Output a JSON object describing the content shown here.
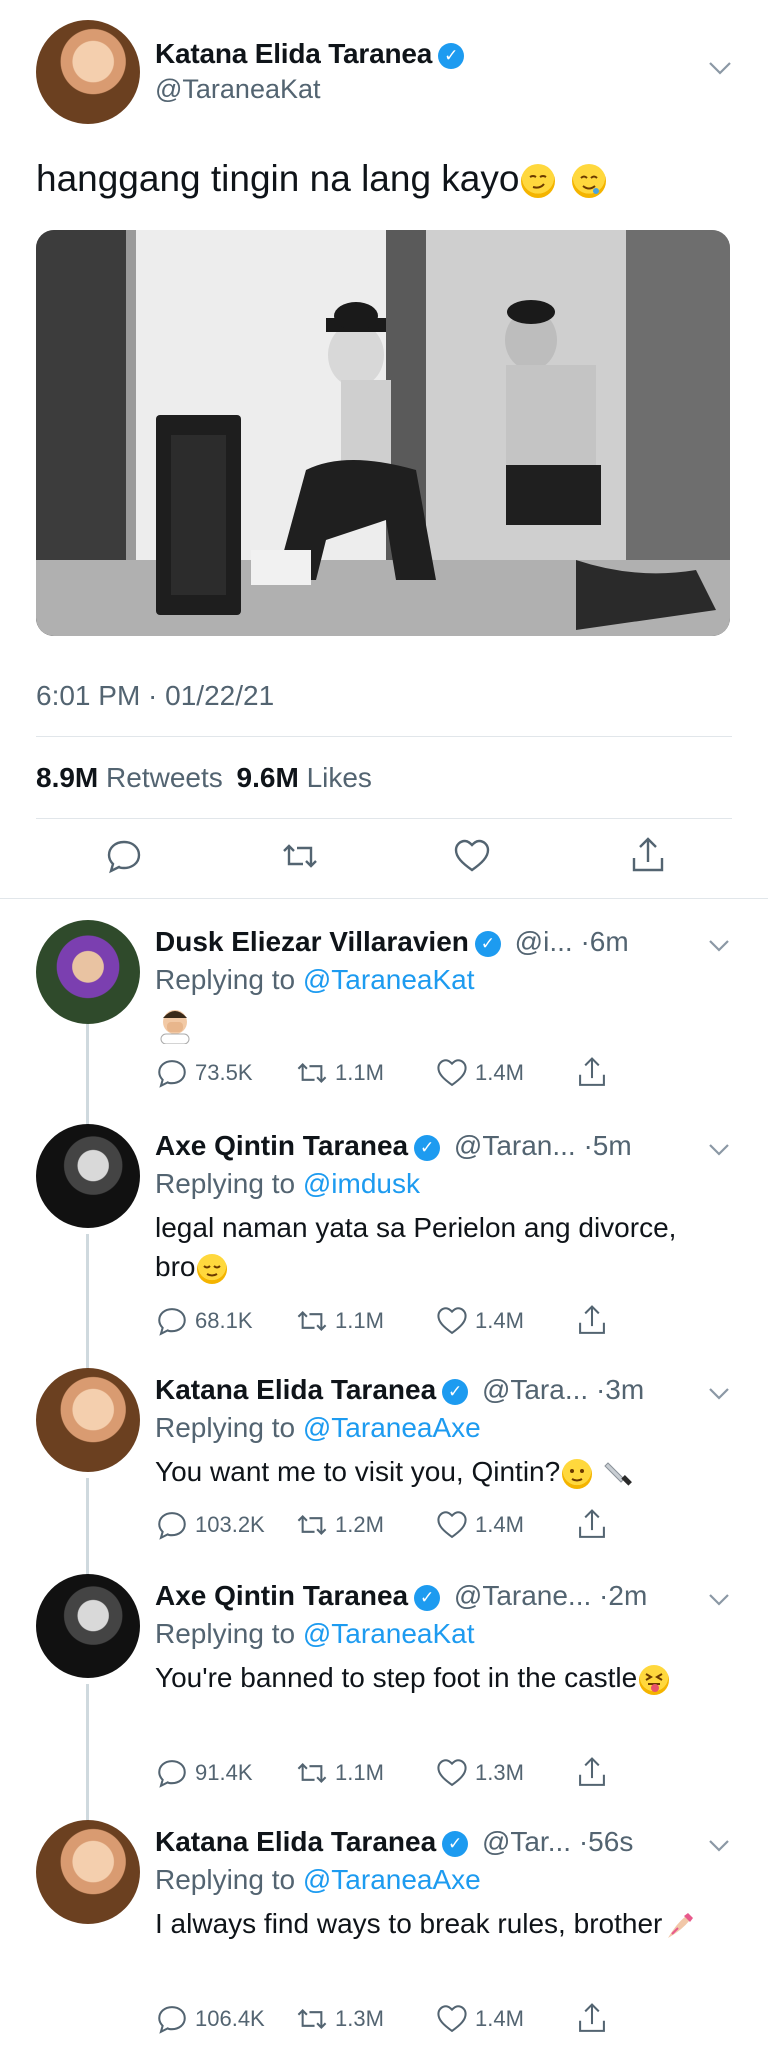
{
  "main_tweet": {
    "name": "Katana Elida Taranea",
    "handle": "@TaraneaKat",
    "text": "hanggang tingin na lang kayo",
    "timestamp": "6:01 PM · 01/22/21",
    "retweets_count": "8.9M",
    "retweets_label": "Retweets",
    "likes_count": "9.6M",
    "likes_label": "Likes"
  },
  "replies": [
    {
      "name": "Dusk Eliezar Villaravien",
      "handle": "@i...",
      "time": "·6m",
      "replying_prefix": "Replying to",
      "replying_to": "@TaraneaKat",
      "text": "",
      "comments": "73.5K",
      "retweets": "1.1M",
      "likes": "1.4M"
    },
    {
      "name": "Axe Qintin Taranea",
      "handle": "@Taran...",
      "time": "·5m",
      "replying_prefix": "Replying to",
      "replying_to": "@imdusk",
      "text": "legal naman yata sa Perielon ang divorce, bro",
      "comments": "68.1K",
      "retweets": "1.1M",
      "likes": "1.4M"
    },
    {
      "name": "Katana Elida Taranea",
      "handle": "@Tara...",
      "time": "·3m",
      "replying_prefix": "Replying to",
      "replying_to": "@TaraneaAxe",
      "text": "You want me to visit you, Qintin?",
      "comments": "103.2K",
      "retweets": "1.2M",
      "likes": "1.4M"
    },
    {
      "name": "Axe Qintin Taranea",
      "handle": "@Tarane...",
      "time": "·2m",
      "replying_prefix": "Replying to",
      "replying_to": "@TaraneaKat",
      "text": "You're banned to step foot in the castle",
      "comments": "91.4K",
      "retweets": "1.1M",
      "likes": "1.3M"
    },
    {
      "name": "Katana Elida Taranea",
      "handle": "@Tar...",
      "time": "·56s",
      "replying_prefix": "Replying to",
      "replying_to": "@TaraneaAxe",
      "text": "I always find ways to break rules, brother",
      "comments": "106.4K",
      "retweets": "1.3M",
      "likes": "1.4M"
    }
  ],
  "colors": {
    "accent": "#1d9bf0",
    "secondary_text": "#536471",
    "divider": "#e1e6ea"
  }
}
